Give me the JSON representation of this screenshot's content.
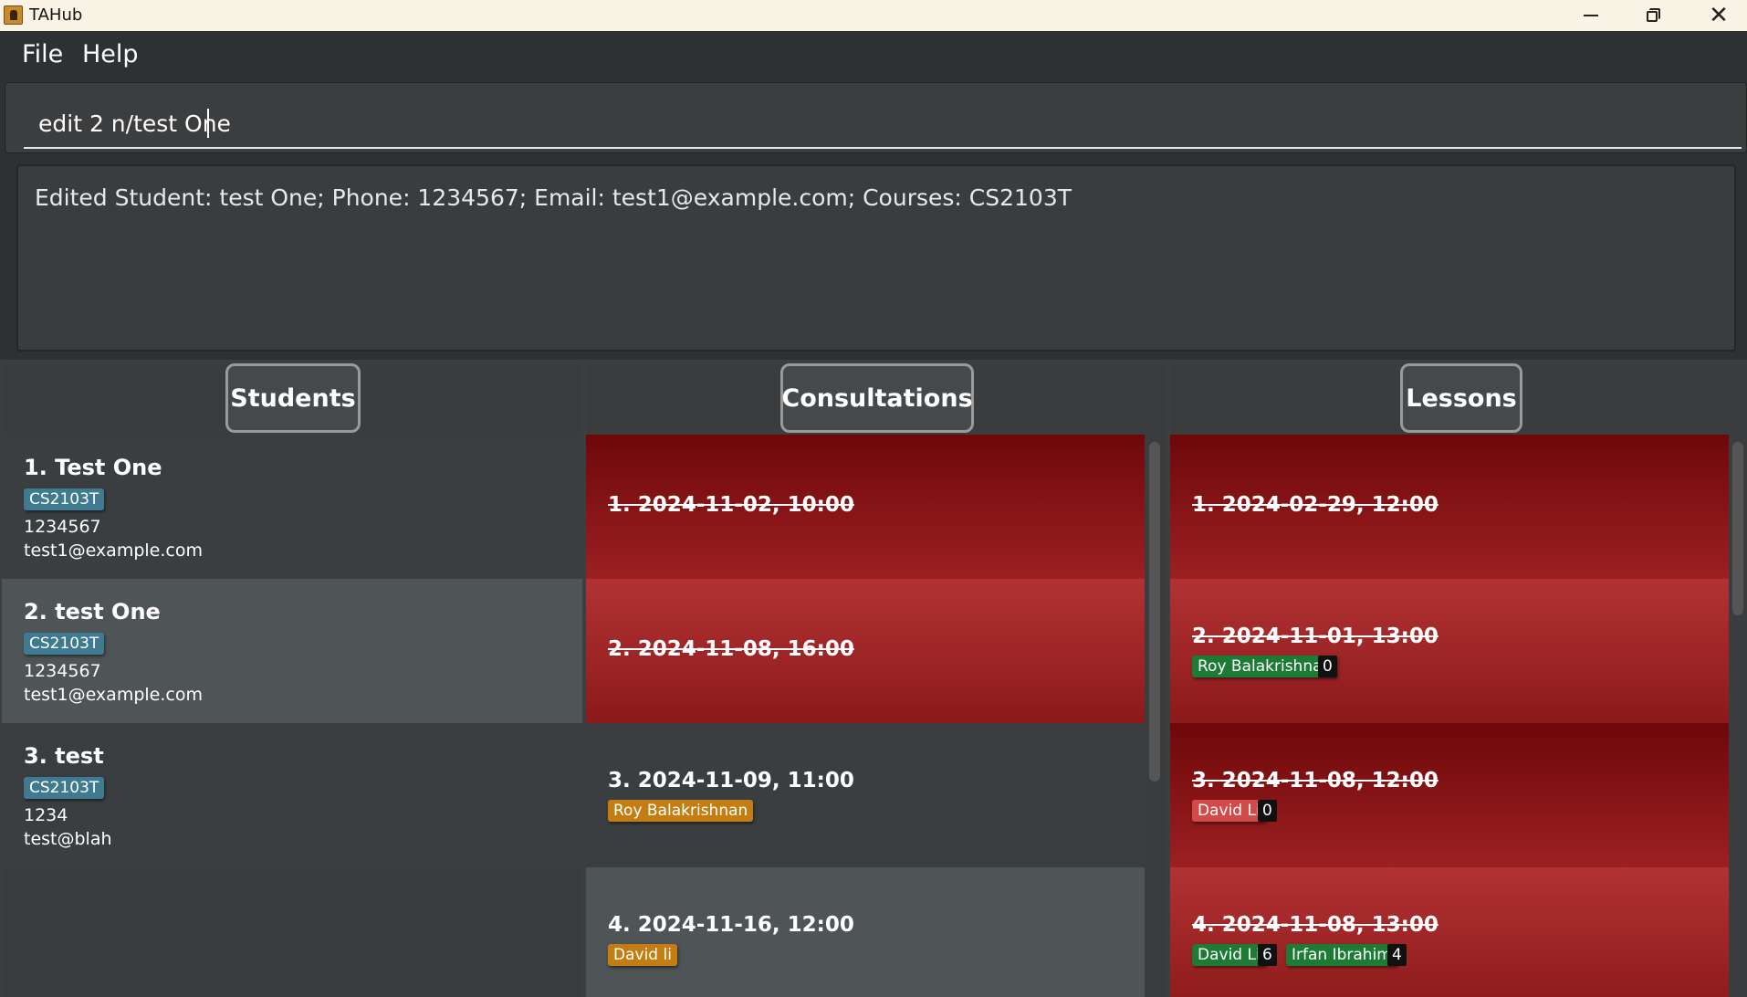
{
  "window": {
    "title": "TAHub"
  },
  "menu": {
    "file": "File",
    "help": "Help"
  },
  "command": {
    "value": "edit 2 n/test One"
  },
  "result": {
    "text": "Edited Student: test One; Phone: 1234567; Email: test1@example.com; Courses: CS2103T"
  },
  "columns": {
    "students": "Students",
    "consultations": "Consultations",
    "lessons": "Lessons"
  },
  "students": [
    {
      "name": "1. Test One",
      "course": "CS2103T",
      "phone": "1234567",
      "email": "test1@example.com"
    },
    {
      "name": "2. test One",
      "course": "CS2103T",
      "phone": "1234567",
      "email": "test1@example.com"
    },
    {
      "name": "3. test",
      "course": "CS2103T",
      "phone": "1234",
      "email": "test@blah"
    }
  ],
  "consultations": [
    {
      "date": "1. 2024-11-02, 10:00",
      "past": true
    },
    {
      "date": "2. 2024-11-08, 16:00",
      "past": true
    },
    {
      "date": "3. 2024-11-09, 11:00",
      "past": false,
      "students": [
        "Roy Balakrishnan"
      ]
    },
    {
      "date": "4. 2024-11-16, 12:00",
      "past": false,
      "students": [
        "David li"
      ]
    }
  ],
  "lessons": [
    {
      "date": "1. 2024-02-29, 12:00",
      "past": true
    },
    {
      "date": "2. 2024-11-01, 13:00",
      "past": true,
      "students": [
        {
          "name": "Roy Balakrishnan",
          "count": "0",
          "present": true
        }
      ]
    },
    {
      "date": "3. 2024-11-08, 12:00",
      "past": true,
      "students": [
        {
          "name": "David Li",
          "count": "0",
          "present": false
        }
      ]
    },
    {
      "date": "4. 2024-11-08, 13:00",
      "past": true,
      "students": [
        {
          "name": "David Li",
          "count": "6",
          "present": true
        },
        {
          "name": "Irfan Ibrahim",
          "count": "4",
          "present": true
        }
      ]
    }
  ],
  "colors": {
    "past_dark": "#6e0809",
    "past_light": "#b23233",
    "course_tag": "#3e7b91",
    "consult_student_tag": "#c47d12",
    "present_tag": "#1d7b36",
    "absent_tag": "#d24a4a"
  }
}
